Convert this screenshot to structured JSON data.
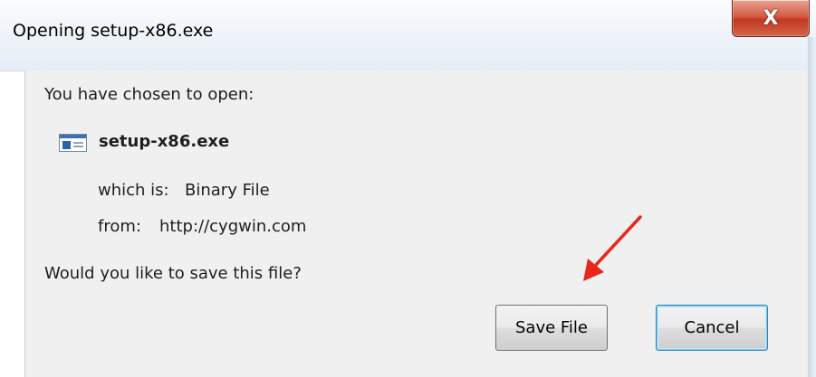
{
  "window": {
    "title": "Opening setup-x86.exe",
    "close_label": "X"
  },
  "dialog": {
    "intro": "You have chosen to open:",
    "file_name": "setup-x86.exe",
    "which_is_label": "which is:",
    "which_is_value": "Binary File",
    "from_label": "from:",
    "from_value": "http://cygwin.com",
    "question": "Would you like to save this file?"
  },
  "buttons": {
    "save_label": "Save File",
    "cancel_label": "Cancel"
  },
  "icons": {
    "file": "application-file-icon",
    "annotation": "red-arrow-icon"
  },
  "colors": {
    "close_button": "#c7432a",
    "annotation_arrow": "#e8261c",
    "default_button_border": "#3c7fb1"
  }
}
